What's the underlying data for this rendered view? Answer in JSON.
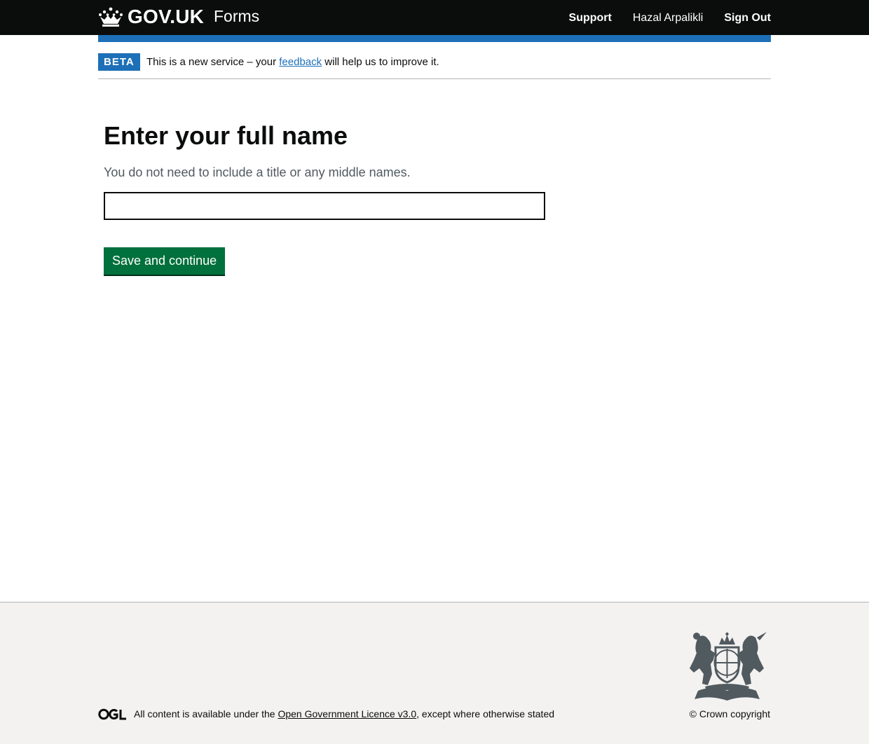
{
  "header": {
    "logo_text": "GOV.UK",
    "service_name": "Forms",
    "nav": {
      "support": "Support",
      "user": "Hazal Arpalikli",
      "sign_out": "Sign Out"
    }
  },
  "phase_banner": {
    "tag": "BETA",
    "text_before": "This is a new service – your ",
    "link": "feedback",
    "text_after": " will help us to improve it."
  },
  "main": {
    "heading": "Enter your full name",
    "hint": "You do not need to include a title or any middle names.",
    "input_value": "",
    "button_label": "Save and continue"
  },
  "footer": {
    "licence_before": "All content is available under the ",
    "licence_link": "Open Government Licence v3.0",
    "licence_after": ", except where otherwise stated",
    "copyright": "© Crown copyright",
    "ogl_logo": "OGL"
  },
  "colors": {
    "header_bg": "#0b0c0c",
    "brand_blue": "#1d70b8",
    "button_green": "#00703c",
    "footer_bg": "#f3f2f1",
    "hint_grey": "#505a5f"
  },
  "icons": [
    "crown-icon",
    "ogl-logo",
    "royal-coat-of-arms"
  ]
}
